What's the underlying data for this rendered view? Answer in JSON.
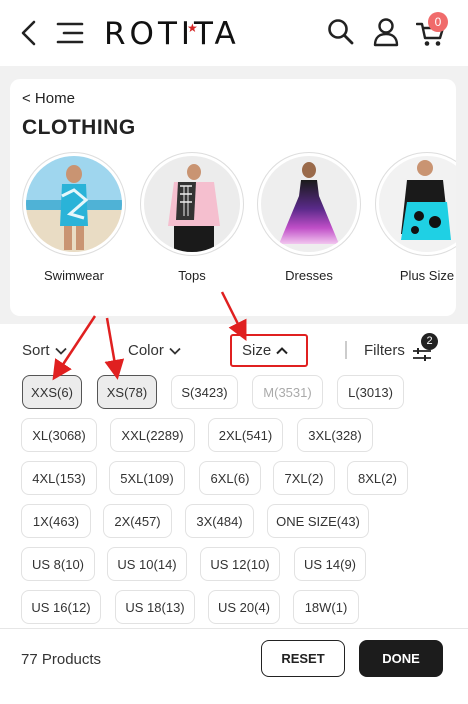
{
  "header": {
    "logo": "ROTITA",
    "cart_count": "0",
    "accent": "#d32525"
  },
  "category": {
    "breadcrumb": "< Home",
    "title": "CLOTHING",
    "items": [
      {
        "label": "Swimwear"
      },
      {
        "label": "Tops"
      },
      {
        "label": "Dresses"
      },
      {
        "label": "Plus Size"
      }
    ]
  },
  "filters": {
    "sort_label": "Sort",
    "color_label": "Color",
    "size_label": "Size",
    "filters_label": "Filters",
    "filters_count": "2",
    "chips": [
      {
        "label": "XXS(6)",
        "state": "selected"
      },
      {
        "label": "XS(78)",
        "state": "selected"
      },
      {
        "label": "S(3423)",
        "state": "normal"
      },
      {
        "label": "M(3531)",
        "state": "disabled"
      },
      {
        "label": "L(3013)",
        "state": "normal"
      },
      {
        "label": "XL(3068)",
        "state": "normal"
      },
      {
        "label": "XXL(2289)",
        "state": "normal"
      },
      {
        "label": "2XL(541)",
        "state": "normal"
      },
      {
        "label": "3XL(328)",
        "state": "normal"
      },
      {
        "label": "4XL(153)",
        "state": "normal"
      },
      {
        "label": "5XL(109)",
        "state": "normal"
      },
      {
        "label": "6XL(6)",
        "state": "normal"
      },
      {
        "label": "7XL(2)",
        "state": "normal"
      },
      {
        "label": "8XL(2)",
        "state": "normal"
      },
      {
        "label": "1X(463)",
        "state": "normal"
      },
      {
        "label": "2X(457)",
        "state": "normal"
      },
      {
        "label": "3X(484)",
        "state": "normal"
      },
      {
        "label": "ONE SIZE(43)",
        "state": "normal"
      },
      {
        "label": "US 8(10)",
        "state": "normal"
      },
      {
        "label": "US 10(14)",
        "state": "normal"
      },
      {
        "label": "US 12(10)",
        "state": "normal"
      },
      {
        "label": "US 14(9)",
        "state": "normal"
      },
      {
        "label": "US 16(12)",
        "state": "normal"
      },
      {
        "label": "US 18(13)",
        "state": "normal"
      },
      {
        "label": "US 20(4)",
        "state": "normal"
      },
      {
        "label": "18W(1)",
        "state": "normal"
      }
    ]
  },
  "footer": {
    "products": "77 Products",
    "reset_label": "RESET",
    "done_label": "DONE"
  },
  "colors": {
    "annotation": "#e02020",
    "dark": "#1c1c1c"
  }
}
